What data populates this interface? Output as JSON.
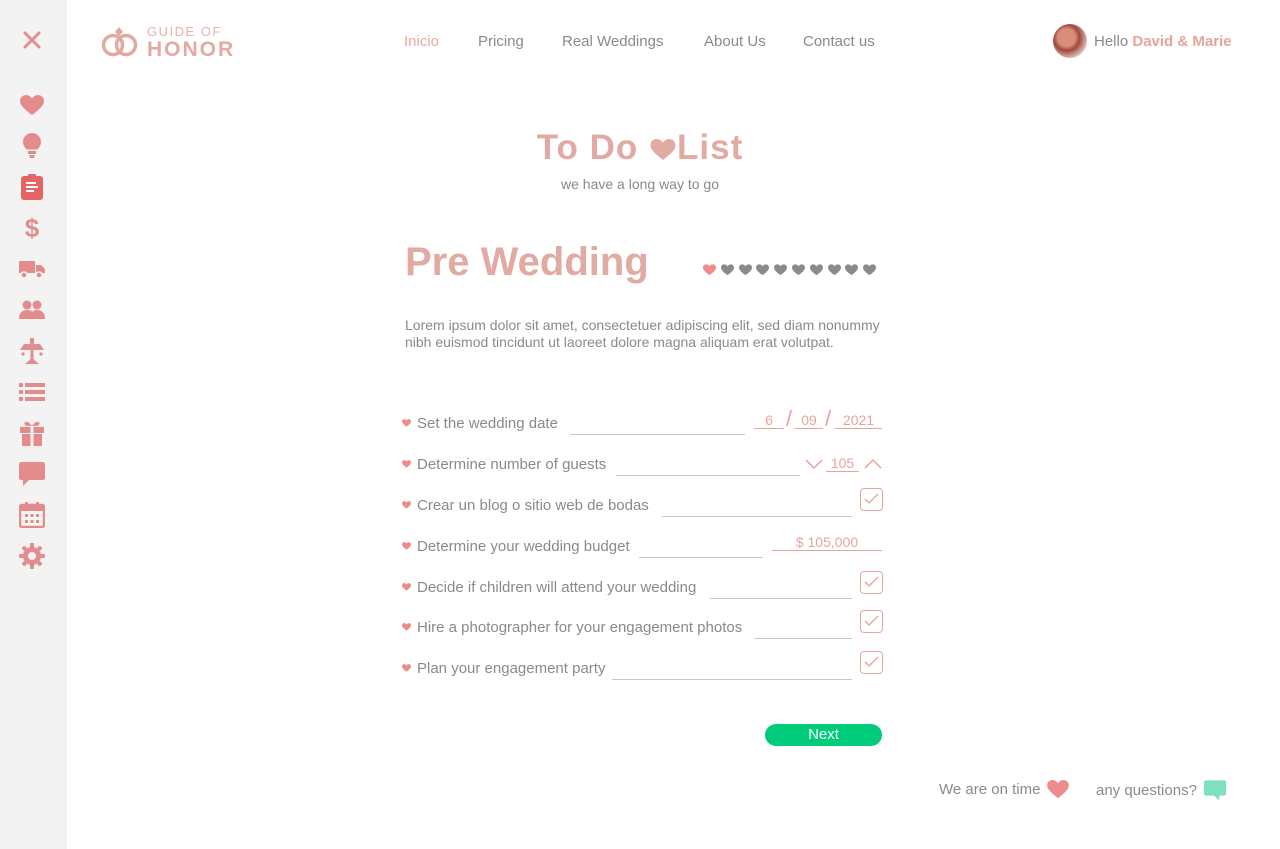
{
  "sidebar": {
    "close_icon": "close-icon",
    "items": [
      {
        "icon": "heart-icon"
      },
      {
        "icon": "lightbulb-icon"
      },
      {
        "icon": "clipboard-icon",
        "active": true
      },
      {
        "icon": "dollar-icon"
      },
      {
        "icon": "truck-icon"
      },
      {
        "icon": "users-icon"
      },
      {
        "icon": "cake-icon"
      },
      {
        "icon": "list-icon"
      },
      {
        "icon": "gift-icon"
      },
      {
        "icon": "chat-icon"
      },
      {
        "icon": "calendar-icon"
      },
      {
        "icon": "gear-icon"
      }
    ]
  },
  "brand": {
    "top": "GUIDE OF",
    "bottom": "HONOR"
  },
  "nav": {
    "items": [
      {
        "label": "Inicio",
        "active": true
      },
      {
        "label": "Pricing"
      },
      {
        "label": "Real Weddings"
      },
      {
        "label": "About Us"
      },
      {
        "label": "Contact us"
      }
    ]
  },
  "user": {
    "greeting": "Hello",
    "name": "David & Marie"
  },
  "page": {
    "title_part1": "To Do",
    "title_part2": "List",
    "subtitle": "we have a long way to go"
  },
  "section": {
    "title": "Pre Wedding",
    "progress": {
      "completed": 1,
      "total": 10
    },
    "description": "Lorem ipsum dolor sit amet, consectetuer adipiscing elit, sed diam no­nummy nibh euismod tincidunt ut laoreet dolore magna aliquam erat vo­lutpat."
  },
  "tasks": [
    {
      "label": "Set the wedding date",
      "day": "6",
      "month": "09",
      "year": "2021"
    },
    {
      "label": "Determine number of guests",
      "value": "105"
    },
    {
      "label": "Crear un blog o sitio web de bodas",
      "checked": true
    },
    {
      "label": "Determine your wedding budget",
      "value": "$ 105,000"
    },
    {
      "label": "Decide if children will attend your wedding",
      "checked": true
    },
    {
      "label": "Hire a photographer for your engagement photos",
      "checked": true
    },
    {
      "label": "Plan your engagement party",
      "checked": true
    }
  ],
  "next_label": "Next",
  "footer": {
    "status": "We are on time",
    "questions": "any questions?"
  },
  "colors": {
    "accent": "#e1aaa2",
    "sidebar_icon": "#e48c8c",
    "active_icon": "#e56464",
    "button": "#00cc7a",
    "chat_bubble": "#7fe0bd",
    "muted_heart": "#8a8a8a",
    "active_heart": "#ee8b8b"
  }
}
